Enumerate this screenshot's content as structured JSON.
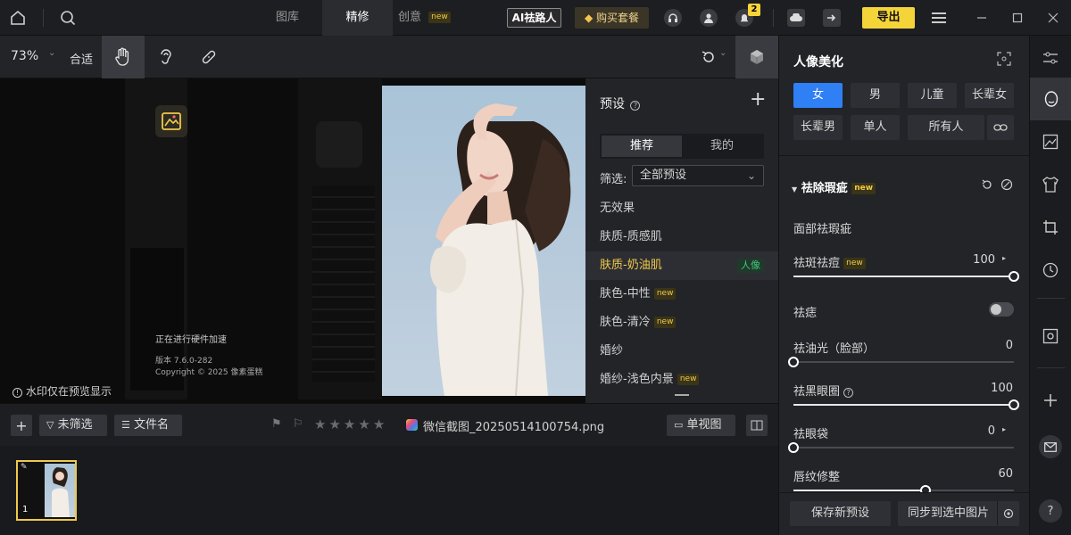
{
  "topbar": {
    "tabs": [
      {
        "label": "图库"
      },
      {
        "label": "精修"
      },
      {
        "label": "创意"
      }
    ],
    "new_tag": "new",
    "ai_brand": "祛路人",
    "ai_prefix": "AI",
    "buy_label": "购买套餐",
    "notification_count": "2",
    "export_label": "导出"
  },
  "toolbar": {
    "zoom": "73%",
    "fit_label": "合适"
  },
  "canvas": {
    "hw_status": "正在进行硬件加速",
    "version": "版本 7.6.0-282",
    "copyright": "Copyright © 2025 像素蛋糕",
    "watermark_note": "水印仅在预览显示"
  },
  "presets": {
    "title": "预设",
    "tab_recommend": "推荐",
    "tab_mine": "我的",
    "filter_label": "筛选:",
    "filter_value": "全部预设",
    "items": [
      {
        "label": "无效果",
        "tag": ""
      },
      {
        "label": "肤质-质感肌",
        "tag": ""
      },
      {
        "label": "肤质-奶油肌",
        "tag": "人像"
      },
      {
        "label": "肤色-中性",
        "tag": "new"
      },
      {
        "label": "肤色-清冷",
        "tag": "new"
      },
      {
        "label": "婚纱",
        "tag": ""
      },
      {
        "label": "婚纱-浅色内景",
        "tag": "new"
      }
    ]
  },
  "bottombar": {
    "unfiltered": "未筛选",
    "filename_sort": "文件名",
    "filename": "微信截图_20250514100754.png",
    "single_view": "单视图"
  },
  "filmstrip": {
    "index": "1"
  },
  "rightpanel": {
    "title": "人像美化",
    "chips": [
      {
        "label": "女",
        "selected": true
      },
      {
        "label": "男",
        "selected": false
      },
      {
        "label": "儿童",
        "selected": false
      },
      {
        "label": "长辈女",
        "selected": false
      },
      {
        "label": "长辈男",
        "selected": false
      },
      {
        "label": "单人",
        "selected": false
      },
      {
        "label": "所有人",
        "selected": false
      }
    ],
    "section_title": "祛除瑕疵",
    "section_tag": "new",
    "subsection": "面部祛瑕疵",
    "sliders": [
      {
        "label": "祛斑祛痘",
        "tag": "new",
        "value": "100",
        "fraction": 1.0,
        "arrow": true
      },
      {
        "label": "祛油光（脸部）",
        "tag": "",
        "value": "0",
        "fraction": 0.0,
        "arrow": false
      },
      {
        "label": "祛黑眼圈",
        "tag": "",
        "value": "100",
        "fraction": 1.0,
        "arrow": false
      },
      {
        "label": "祛眼袋",
        "tag": "",
        "value": "0",
        "fraction": 0.0,
        "arrow": true
      },
      {
        "label": "唇纹修整",
        "tag": "",
        "value": "60",
        "fraction": 0.6,
        "arrow": false
      }
    ],
    "toggle_label": "祛痣",
    "toggle_on": false,
    "save_preset": "保存新预设",
    "sync_label": "同步到选中图片"
  },
  "rail": {
    "help": "?"
  },
  "colors": {
    "accent": "#2f7ff5",
    "export": "#f5d43a",
    "highlight": "#f0c94a"
  }
}
